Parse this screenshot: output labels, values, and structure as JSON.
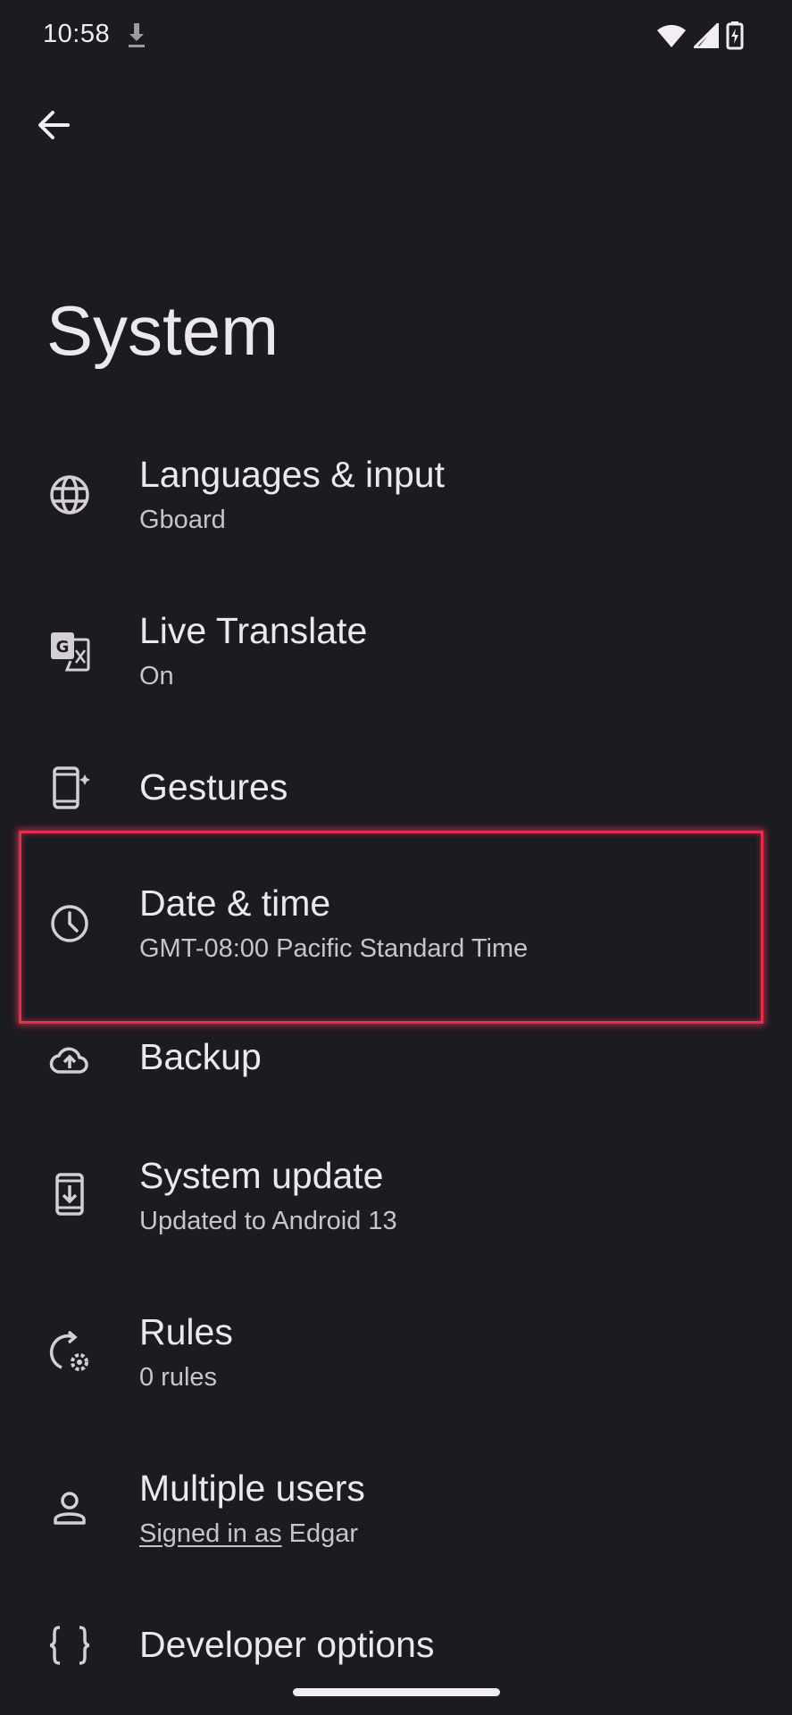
{
  "status_bar": {
    "time": "10:58",
    "icons": [
      "download-icon",
      "wifi-icon",
      "cellular-signal-icon",
      "battery-charging-icon"
    ]
  },
  "header": {
    "back_icon": "arrow-back-icon",
    "title": "System"
  },
  "items": [
    {
      "icon": "globe-icon",
      "title": "Languages & input",
      "subtitle": "Gboard"
    },
    {
      "icon": "translate-icon",
      "title": "Live Translate",
      "subtitle": "On"
    },
    {
      "icon": "gestures-phone-icon",
      "title": "Gestures",
      "subtitle": ""
    },
    {
      "icon": "clock-icon",
      "title": "Date & time",
      "subtitle": "GMT-08:00 Pacific Standard Time"
    },
    {
      "icon": "cloud-upload-icon",
      "title": "Backup",
      "subtitle": ""
    },
    {
      "icon": "system-update-icon",
      "title": "System update",
      "subtitle": "Updated to Android 13"
    },
    {
      "icon": "rules-icon",
      "title": "Rules",
      "subtitle": "0 rules"
    },
    {
      "icon": "person-icon",
      "title": "Multiple users",
      "subtitle_underlined": "Signed in as",
      "subtitle_rest": " Edgar"
    },
    {
      "icon": "code-braces-icon",
      "title": "Developer options",
      "subtitle": ""
    }
  ],
  "highlight": {
    "target": "Date & time",
    "color": "#e0304e"
  },
  "colors": {
    "background": "#1c1b21",
    "text_primary": "#ece8ee",
    "text_secondary": "#c9c4cc"
  }
}
